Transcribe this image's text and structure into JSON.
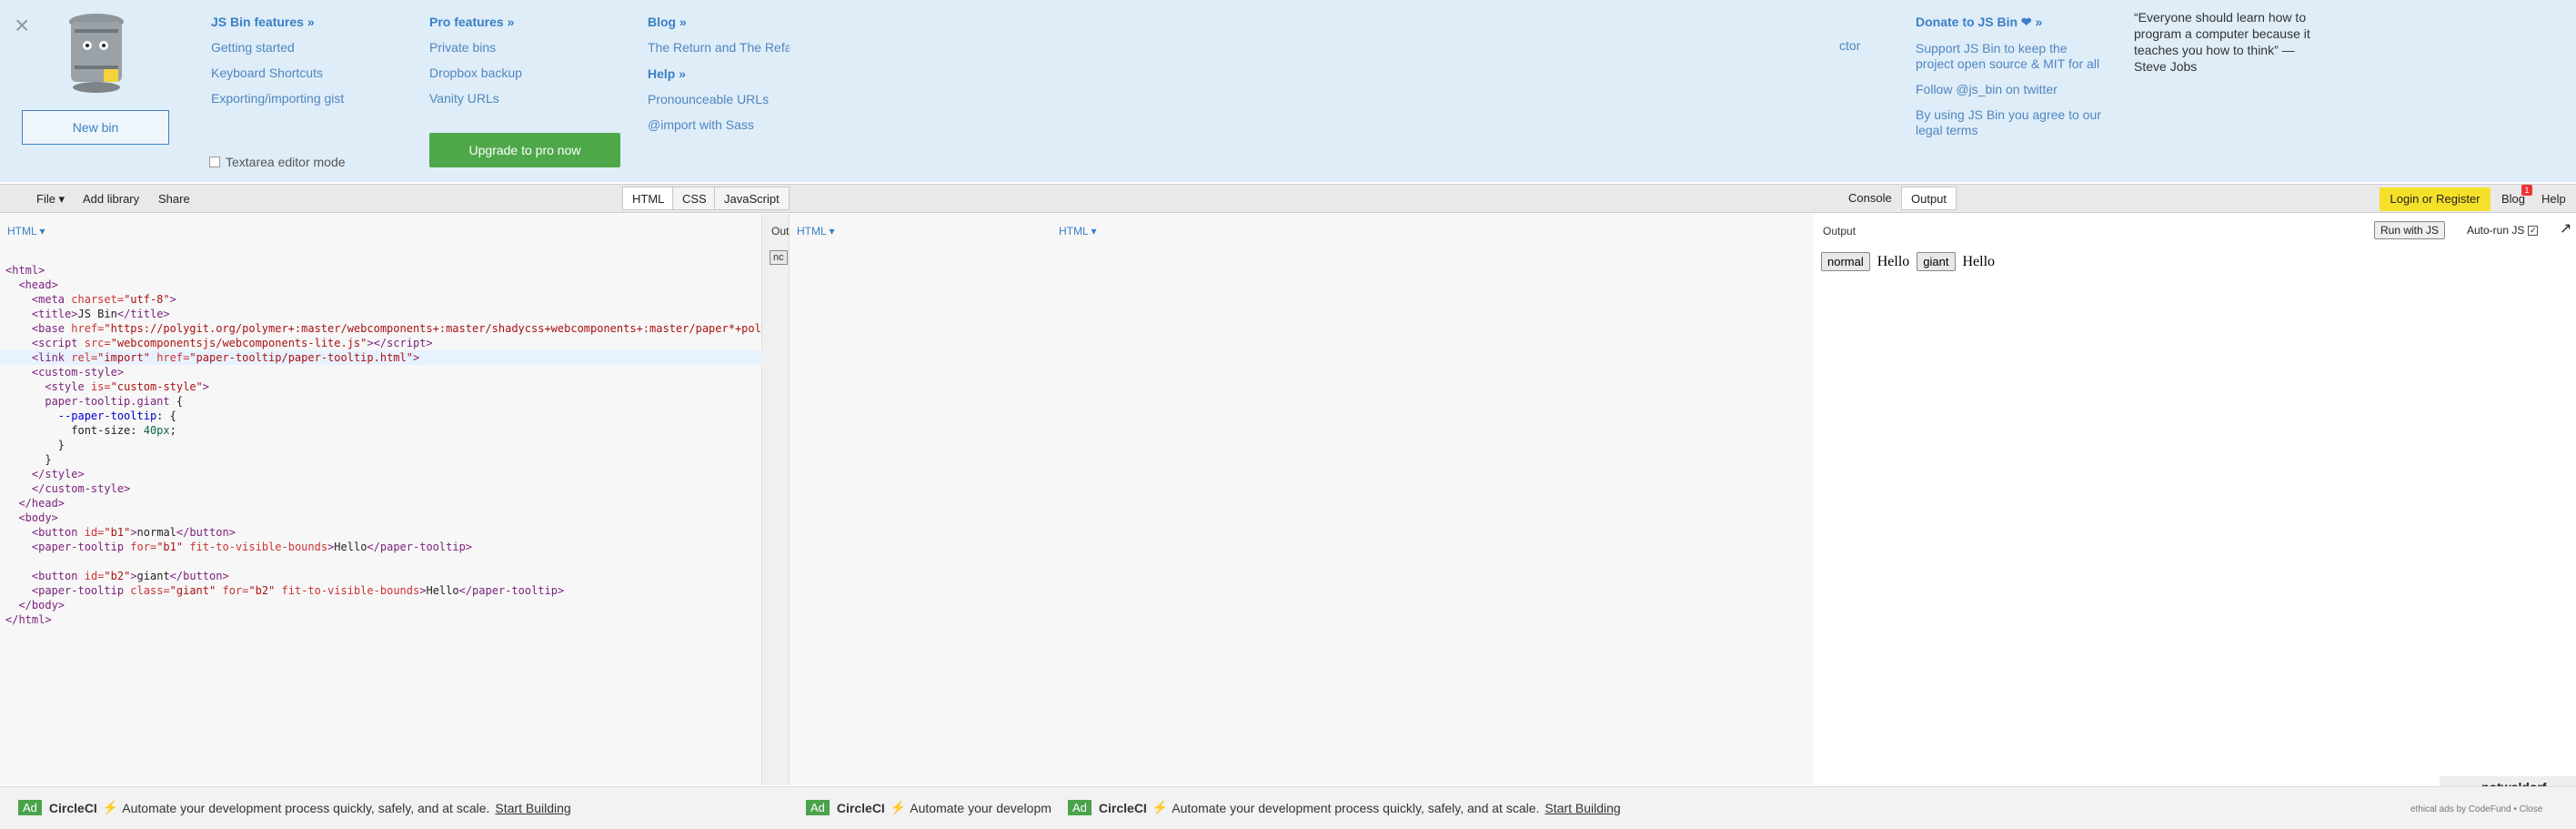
{
  "menu": {
    "new_bin": "New bin",
    "textarea_mode": "Textarea editor mode",
    "upgrade": "Upgrade to pro now",
    "features": {
      "title": "JS Bin features »",
      "items": [
        "Getting started",
        "Keyboard Shortcuts",
        "Exporting/importing gist"
      ]
    },
    "pro": {
      "title": "Pro features »",
      "items": [
        "Private bins",
        "Dropbox backup",
        "Vanity URLs"
      ]
    },
    "blog": {
      "title": "Blog »",
      "items": [
        "The Return and The Refa"
      ]
    },
    "help": {
      "title": "Help »",
      "items": [
        "Pronounceable URLs",
        "@import with Sass"
      ]
    },
    "ctor_fragment": "ctor",
    "donate": {
      "title": "Donate to JS Bin ❤ »",
      "items": [
        "Support JS Bin to keep the project open source & MIT for all",
        "Follow @js_bin on twitter",
        "By using JS Bin you agree to our legal terms"
      ]
    },
    "quote": "“Everyone should learn how to program a computer because it teaches you how to think” —",
    "quote_author": "Steve Jobs"
  },
  "toolbar": {
    "file": "File ▾",
    "add_library": "Add library",
    "share": "Share",
    "tabs": [
      "HTML",
      "CSS",
      "JavaScript"
    ],
    "tabs_right": [
      "Console",
      "Output"
    ],
    "login": "Login or Register",
    "blog": "Blog",
    "blog_badge": "1",
    "help": "Help"
  },
  "panels": {
    "html_label": "HTML ▾",
    "mid_label_1": "HTML ▾",
    "mid_label_2": "HTML ▾",
    "mid_out_fragment": "Out",
    "mid_btn_fragment": "nc",
    "output_label": "Output",
    "run_js": "Run with JS",
    "autorun": "Auto-run JS",
    "out_btn1": "normal",
    "out_text1": "Hello",
    "out_btn2": "giant",
    "out_text2": "Hello",
    "popout_icon": "↗",
    "popout_icon_name": "popout-icon",
    "corner_badge": "notwaldorf"
  },
  "code": {
    "base_href": "\"https://polygit.org/polymer+:master/webcomponents+:master/shadycss+webcomponents+:master/paper*+polymerelements+:master/iron*+polymerelements+:master/app*+polymerelements+:master/neon*+polymerelements+:master/components/\""
  },
  "ads": [
    {
      "tag": "Ad",
      "brand": "CircleCI",
      "text": "Automate your development process quickly, safely, and at scale.",
      "cta": "Start Building"
    },
    {
      "tag": "Ad",
      "brand": "CircleCI",
      "text": "Automate your developm",
      "cta": ""
    },
    {
      "tag": "Ad",
      "brand": "CircleCI",
      "text": "Automate your development process quickly, safely, and at scale.",
      "cta": "Start Building"
    }
  ],
  "ethical": "ethical ads by CodeFund • Close",
  "colors": {
    "accent": "#3a7fc7",
    "upgrade": "#4ea84a",
    "login": "#f5e12a",
    "menu_bg": "#dfedf8"
  }
}
